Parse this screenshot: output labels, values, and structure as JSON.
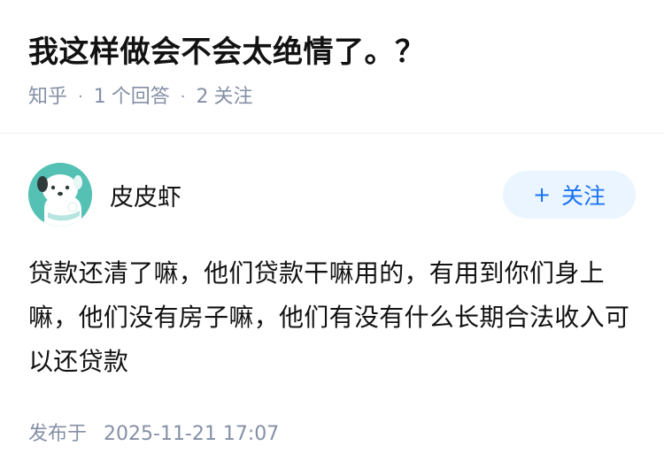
{
  "question": {
    "title": "我这样做会不会太绝情了。？",
    "source": "知乎",
    "answers_count": "1",
    "answers_label": "个回答",
    "followers_count": "2",
    "followers_label": "关注"
  },
  "answer": {
    "author": "皮皮虾",
    "follow_plus": "+",
    "follow_label": "关注",
    "content": "贷款还清了嘛，他们贷款干嘛用的，有用到你们身上嘛，他们没有房子嘛，他们有没有什么长期合法收入可以还贷款",
    "published_label": "发布于",
    "published_date": "2025-11-21 17:07"
  },
  "colors": {
    "title": "#121212",
    "meta": "#8590a6",
    "accent": "#1772f6",
    "follow_bg": "#ebf5ff",
    "avatar_bg": "#55c1b4"
  },
  "icons": {
    "avatar": "dog-avatar-icon"
  }
}
